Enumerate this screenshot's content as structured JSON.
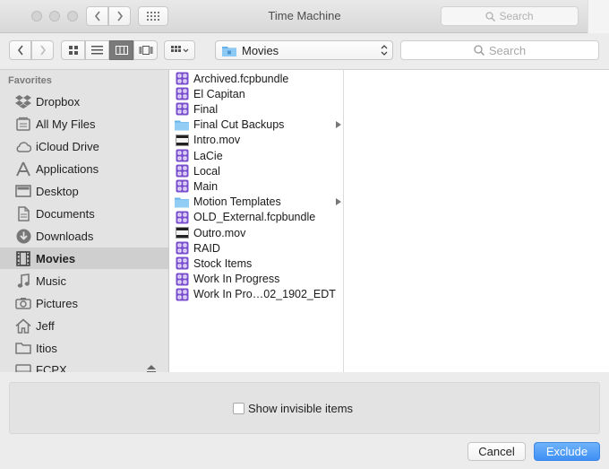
{
  "window": {
    "title": "Time Machine"
  },
  "titlebar": {
    "search_placeholder": "Search"
  },
  "toolbar": {
    "path_label": "Movies",
    "search_placeholder": "Search",
    "accent": "#7a7a7a"
  },
  "sidebar": {
    "heading": "Favorites",
    "items": [
      {
        "label": "Dropbox",
        "icon": "dropbox-icon"
      },
      {
        "label": "All My Files",
        "icon": "all-files-icon"
      },
      {
        "label": "iCloud Drive",
        "icon": "cloud-icon"
      },
      {
        "label": "Applications",
        "icon": "applications-icon"
      },
      {
        "label": "Desktop",
        "icon": "desktop-icon"
      },
      {
        "label": "Documents",
        "icon": "documents-icon"
      },
      {
        "label": "Downloads",
        "icon": "downloads-icon"
      },
      {
        "label": "Movies",
        "icon": "movies-icon",
        "selected": true
      },
      {
        "label": "Music",
        "icon": "music-icon"
      },
      {
        "label": "Pictures",
        "icon": "pictures-icon"
      },
      {
        "label": "Jeff",
        "icon": "home-icon"
      },
      {
        "label": "Itios",
        "icon": "folder-icon"
      },
      {
        "label": "FCPX",
        "icon": "drive-icon"
      }
    ]
  },
  "files": [
    {
      "label": "Archived.fcpbundle",
      "icon": "fcp-bundle-icon"
    },
    {
      "label": "El Capitan",
      "icon": "fcp-bundle-icon"
    },
    {
      "label": "Final",
      "icon": "fcp-bundle-icon"
    },
    {
      "label": "Final Cut Backups",
      "icon": "folder-icon",
      "disclosure": true
    },
    {
      "label": "Intro.mov",
      "icon": "movie-file-icon"
    },
    {
      "label": "LaCie",
      "icon": "fcp-bundle-icon"
    },
    {
      "label": "Local",
      "icon": "fcp-bundle-icon"
    },
    {
      "label": "Main",
      "icon": "fcp-bundle-icon"
    },
    {
      "label": "Motion Templates",
      "icon": "folder-icon",
      "disclosure": true
    },
    {
      "label": "OLD_External.fcpbundle",
      "icon": "fcp-bundle-icon"
    },
    {
      "label": "Outro.mov",
      "icon": "movie-file-icon"
    },
    {
      "label": "RAID",
      "icon": "fcp-bundle-icon"
    },
    {
      "label": "Stock Items",
      "icon": "fcp-bundle-icon"
    },
    {
      "label": "Work In Progress",
      "icon": "fcp-bundle-icon"
    },
    {
      "label": "Work In Pro…02_1902_EDT",
      "icon": "fcp-bundle-icon"
    }
  ],
  "options": {
    "show_invisible_label": "Show invisible items",
    "show_invisible_checked": false
  },
  "buttons": {
    "cancel": "Cancel",
    "exclude": "Exclude",
    "exclude_color": "#3f8ff5"
  }
}
